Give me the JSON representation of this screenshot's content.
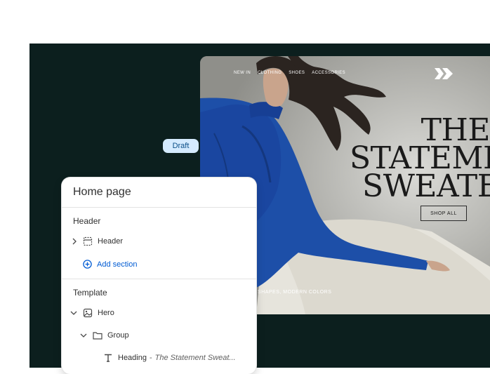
{
  "preview": {
    "nav": [
      "NEW IN",
      "CLOTHING",
      "SHOES",
      "ACCESSORIES"
    ],
    "headline": [
      "THE",
      "STATEMENT",
      "SWEATER"
    ],
    "shop_button": "SHOP ALL",
    "tagline": "SHAPES, MODERN COLORS"
  },
  "badge": {
    "label": "Draft",
    "color": "#d5ebff"
  },
  "panel": {
    "title": "Home page",
    "header_section": "Header",
    "header_item": "Header",
    "add_section": "Add section",
    "template_section": "Template",
    "hero": "Hero",
    "group": "Group",
    "heading_label": "Heading",
    "heading_value": "The Statement Sweat..."
  },
  "colors": {
    "stage": "#0c1f1e",
    "accent": "#005bd3",
    "sweater": "#1d4fa8"
  }
}
